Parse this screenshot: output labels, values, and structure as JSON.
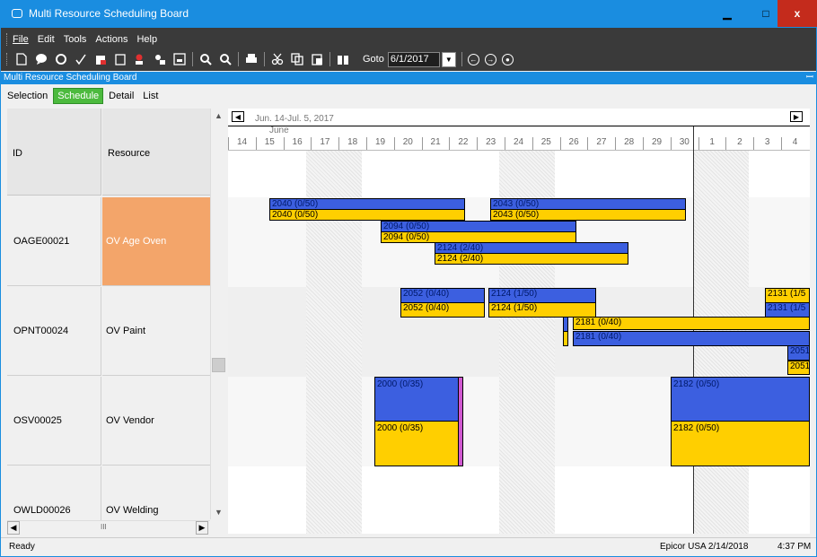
{
  "window": {
    "title": "Multi Resource Scheduling Board",
    "minimize": "▁",
    "maximize": "□",
    "close": "x"
  },
  "menu": [
    "File",
    "Edit",
    "Tools",
    "Actions",
    "Help"
  ],
  "toolbar": {
    "goto_label": "Goto",
    "goto_value": "6/1/2017"
  },
  "panel": {
    "title": "Multi Resource Scheduling Board",
    "pin": "ꟷ"
  },
  "tabs": [
    {
      "label": "Selection",
      "active": false
    },
    {
      "label": "Schedule",
      "active": true
    },
    {
      "label": "Detail",
      "active": false
    },
    {
      "label": "List",
      "active": false
    }
  ],
  "grid": {
    "col_id": "ID",
    "col_resource": "Resource",
    "rows": [
      {
        "id": "OAGE00021",
        "resource": "OV Age Oven",
        "selected": true
      },
      {
        "id": "OPNT00024",
        "resource": "OV Paint",
        "selected": false
      },
      {
        "id": "OSV00025",
        "resource": "OV Vendor",
        "selected": false
      },
      {
        "id": "OWLD00026",
        "resource": "OV Welding",
        "selected": false
      }
    ]
  },
  "gantt": {
    "range_label": "Jun. 14-Jul. 5, 2017",
    "month_label": "June",
    "days": [
      "14",
      "15",
      "16",
      "17",
      "18",
      "19",
      "20",
      "21",
      "22",
      "23",
      "24",
      "25",
      "26",
      "27",
      "28",
      "29",
      "30",
      "1",
      "2",
      "3",
      "4"
    ],
    "bars": [
      {
        "label": "2040 (0/50)",
        "color": "#3c5fe0"
      },
      {
        "label": "2040 (0/50)",
        "color": "#ffcf00"
      },
      {
        "label": "2043 (0/50)",
        "color": "#3c5fe0"
      },
      {
        "label": "2043 (0/50)",
        "color": "#ffcf00"
      },
      {
        "label": "2094 (0/50)",
        "color": "#3c5fe0"
      },
      {
        "label": "2094 (0/50)",
        "color": "#ffcf00"
      },
      {
        "label": "2124 (2/40)",
        "color": "#3c5fe0"
      },
      {
        "label": "2124 (2/40)",
        "color": "#ffcf00"
      },
      {
        "label": "2052 (0/40)",
        "color": "#3c5fe0"
      },
      {
        "label": "2052 (0/40)",
        "color": "#ffcf00"
      },
      {
        "label": "2124 (1/50)",
        "color": "#3c5fe0"
      },
      {
        "label": "2124 (1/50)",
        "color": "#ffcf00"
      },
      {
        "label": "2131 (1/5",
        "color": "#ffcf00"
      },
      {
        "label": "2131 (1/5",
        "color": "#3c5fe0"
      },
      {
        "label": "2181 (0/40)",
        "color": "#ffcf00"
      },
      {
        "label": "2181 (0/40)",
        "color": "#3c5fe0"
      },
      {
        "label": "2051",
        "color": "#3c5fe0"
      },
      {
        "label": "2051",
        "color": "#ffcf00"
      },
      {
        "label": "2000 (0/35)",
        "color": "#3c5fe0"
      },
      {
        "label": "2000 (0/35)",
        "color": "#ffcf00"
      },
      {
        "label": "2182 (0/50)",
        "color": "#3c5fe0"
      },
      {
        "label": "2182 (0/50)",
        "color": "#ffcf00"
      }
    ]
  },
  "status": {
    "left": "Ready",
    "company": "Epicor USA  2/14/2018",
    "time": "4:37 PM"
  }
}
